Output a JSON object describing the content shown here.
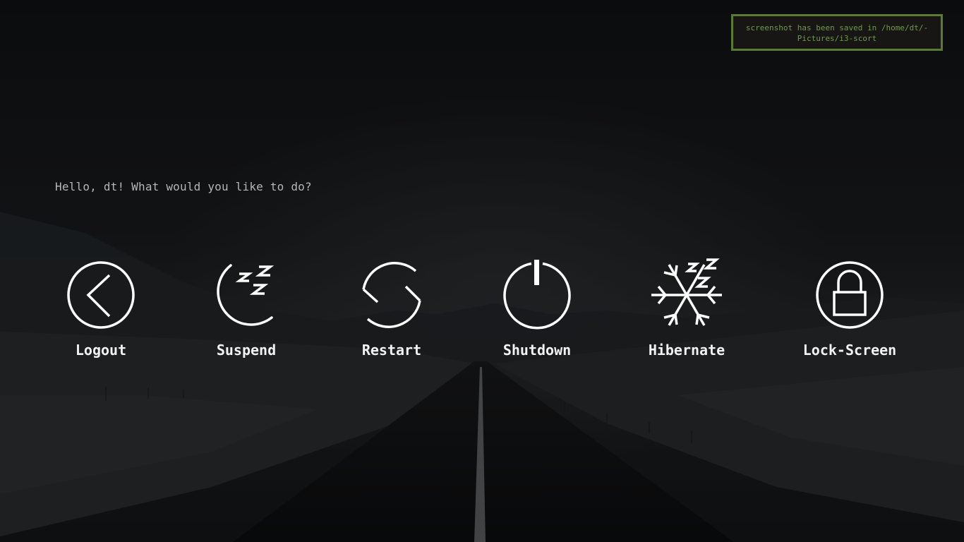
{
  "notification": {
    "line1": "screenshot has been saved in /home/dt/-",
    "line2": "Pictures/i3-scort"
  },
  "greeting": "Hello, dt! What would you like to do?",
  "actions": [
    {
      "label": "Logout",
      "icon": "logout-icon"
    },
    {
      "label": "Suspend",
      "icon": "moon-sleep-icon"
    },
    {
      "label": "Restart",
      "icon": "restart-icon"
    },
    {
      "label": "Shutdown",
      "icon": "power-icon"
    },
    {
      "label": "Hibernate",
      "icon": "snowflake-sleep-icon"
    },
    {
      "label": "Lock-Screen",
      "icon": "lock-icon"
    }
  ],
  "colors": {
    "notification_border": "#5a7a36",
    "notification_text": "#6f9a45",
    "icon_stroke": "#ffffff",
    "greeting_text": "#b6b6b6"
  }
}
